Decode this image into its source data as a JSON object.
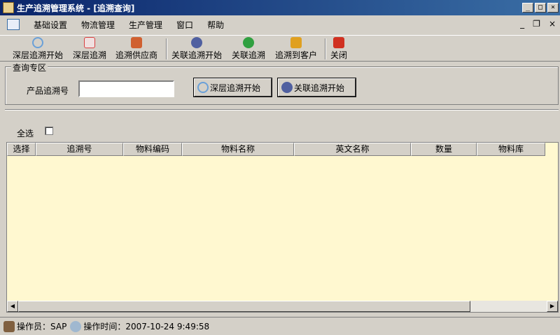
{
  "window": {
    "title": "生产追溯管理系统 - [追溯查询]",
    "min": "_",
    "max": "□",
    "close": "×"
  },
  "menu": {
    "items": [
      "基础设置",
      "物流管理",
      "生产管理",
      "窗口",
      "帮助"
    ],
    "mdi_min": "_",
    "mdi_restore": "❐",
    "mdi_close": "×"
  },
  "toolbar": {
    "items": [
      {
        "label": "深层追溯开始",
        "icon": "magnifier-icon",
        "color": "#6aa0d8"
      },
      {
        "label": "深层追溯",
        "icon": "chart-doc-icon",
        "color": "#d84040"
      },
      {
        "label": "追溯供应商",
        "icon": "house-icon",
        "color": "#d06030"
      },
      {
        "label": "关联追溯开始",
        "icon": "magnifier-person-icon",
        "color": "#5060a0"
      },
      {
        "label": "关联追溯",
        "icon": "refresh-green-icon",
        "color": "#30a040"
      },
      {
        "label": "追溯到客户",
        "icon": "customer-icon",
        "color": "#e0a020"
      },
      {
        "label": "关闭",
        "icon": "power-icon",
        "color": "#d03020"
      }
    ]
  },
  "query": {
    "group_title": "查询专区",
    "product_label": "产品追溯号",
    "product_value": "",
    "deep_button": "深层追溯开始",
    "related_button": "关联追溯开始"
  },
  "grid": {
    "select_all": "全选",
    "columns": [
      "选择",
      "追溯号",
      "物料编码",
      "物料名称",
      "英文名称",
      "数量",
      "物料库"
    ],
    "rows": []
  },
  "status": {
    "operator_label": "操作员：",
    "operator": "SAP",
    "time_label": "操作时间：",
    "time": "2007-10-24 9:49:58"
  },
  "colors": {
    "title_bar": "#0a246a",
    "grid_bg": "#fff8d0",
    "face": "#d4d0c8"
  }
}
